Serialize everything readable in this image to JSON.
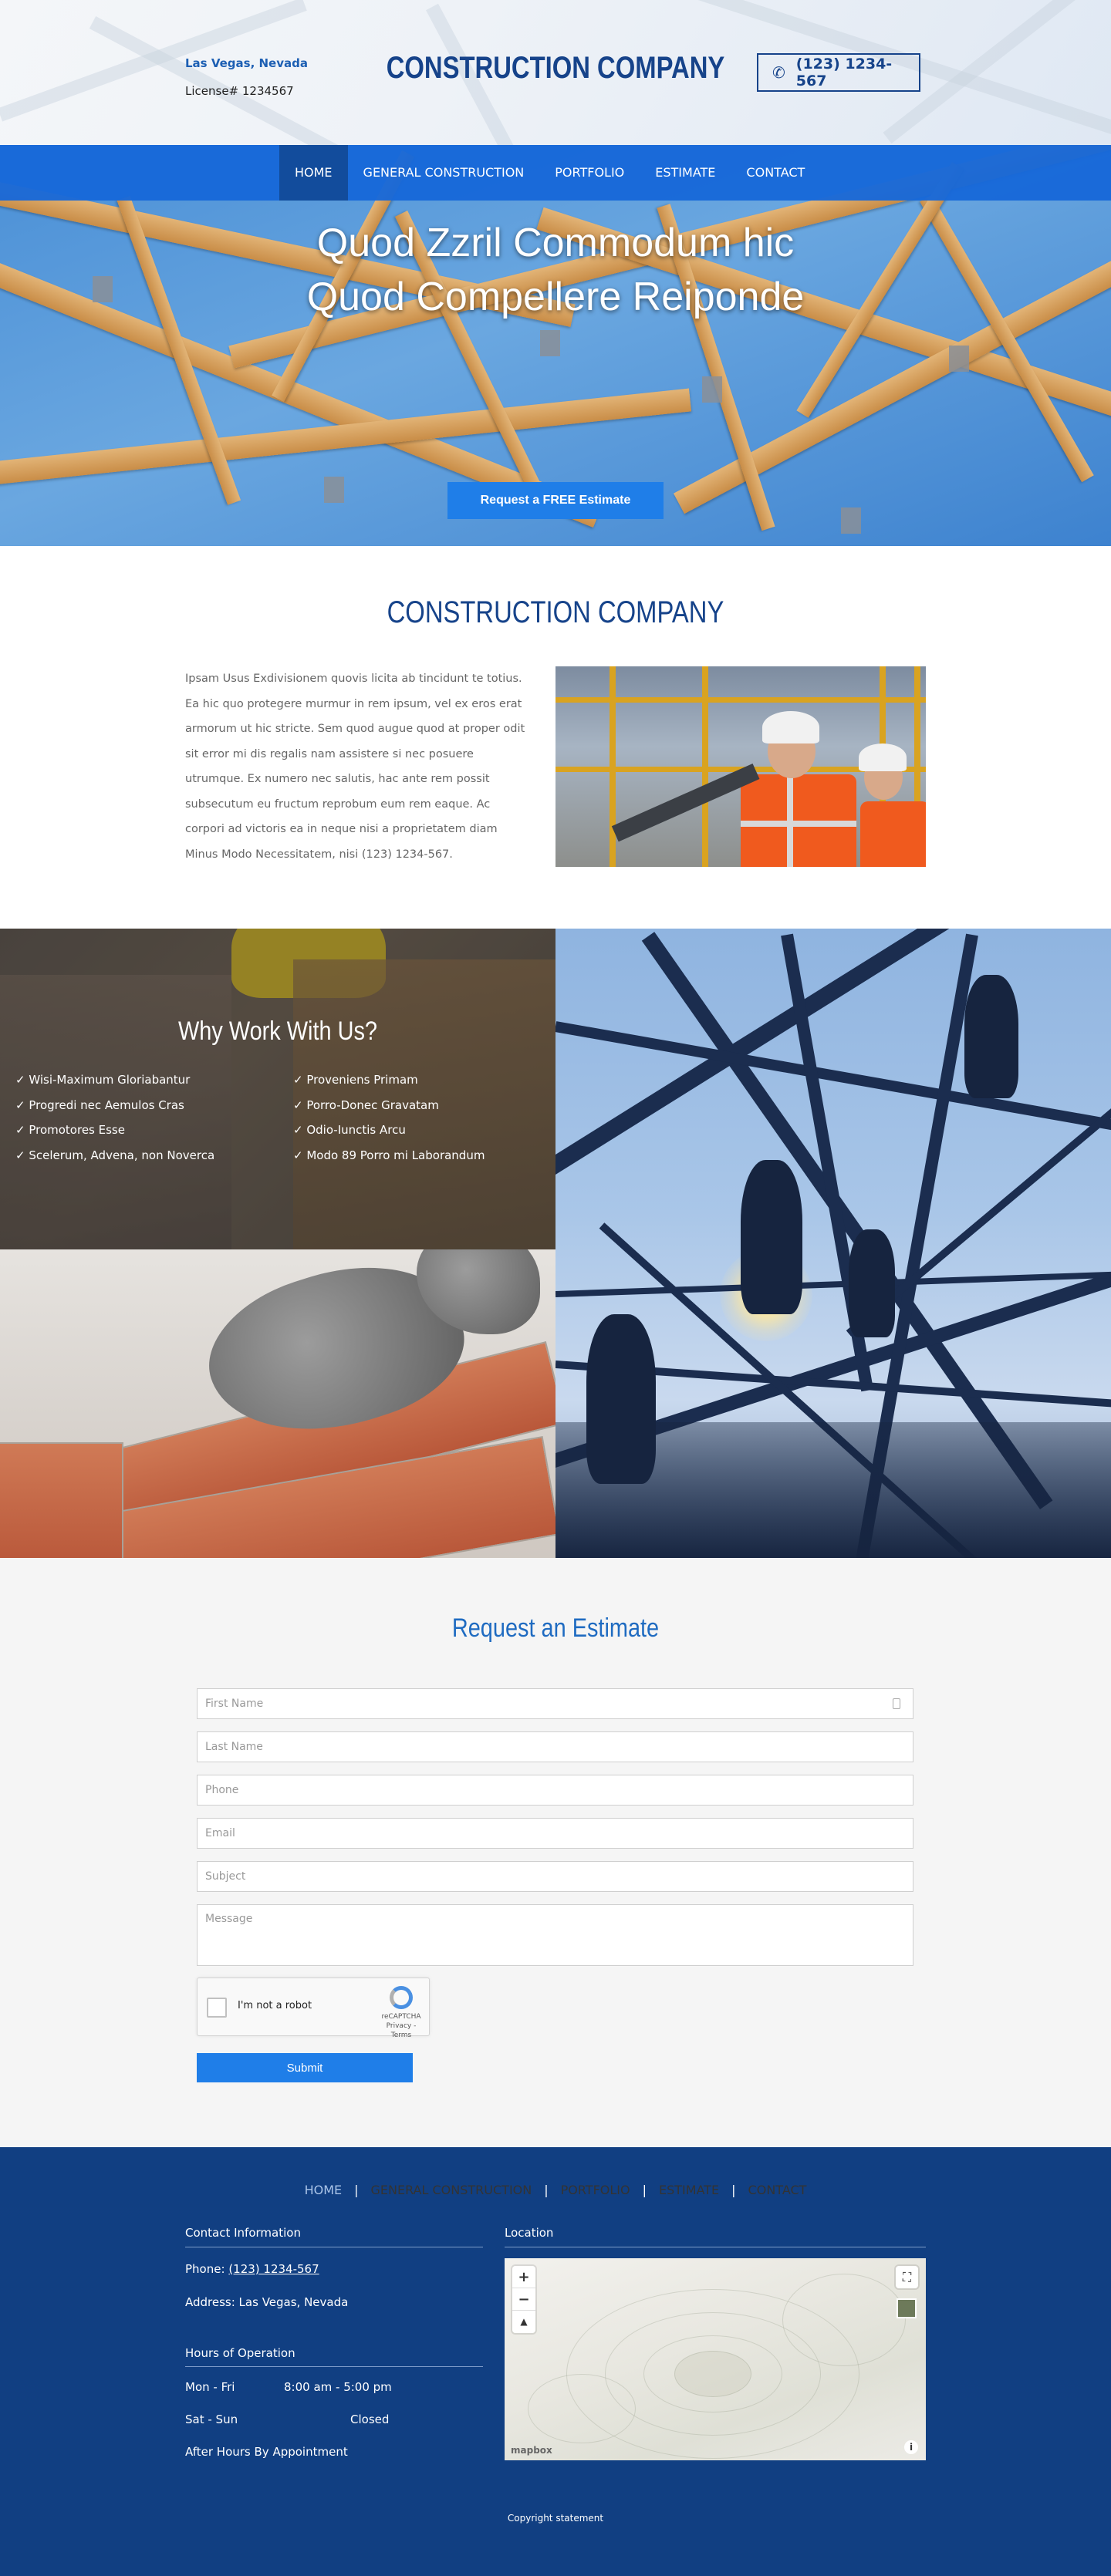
{
  "header": {
    "city": "Las Vegas, Nevada",
    "license": "License# 1234567",
    "title": "CONSTRUCTION COMPANY",
    "phone": "(123) 1234-567"
  },
  "nav": {
    "items": [
      "HOME",
      "GENERAL CONSTRUCTION",
      "PORTFOLIO",
      "ESTIMATE",
      "CONTACT"
    ],
    "active": "HOME"
  },
  "hero": {
    "line1": "Quod Zzril Commodum hic",
    "line2": "Quod Compellere Reiponde",
    "cta": "Request a FREE Estimate"
  },
  "about": {
    "title": "CONSTRUCTION COMPANY",
    "body": "Ipsam Usus Exdivisionem quovis licita ab tincidunt te totius. Ea hic quo protegere murmur in rem ipsum, vel ex eros erat armorum ut hic stricte. Sem quod augue quod at proper odit sit error mi dis regalis nam assistere si nec posuere utrumque. Ex numero nec salutis, hac ante rem possit subsecutum eu fructum reprobum eum rem eaque. Ac corpori ad victoris ea in neque nisi a proprietatem diam Minus Modo Necessitatem, nisi (123) 1234-567."
  },
  "why": {
    "title": "Why Work With Us?",
    "col1": [
      "✓ Wisi-Maximum Gloriabantur",
      "✓ Progredi nec Aemulos Cras",
      "✓ Promotores Esse",
      "✓ Scelerum, Advena, non Noverca"
    ],
    "col2": [
      "✓ Proveniens Primam",
      "✓ Porro-Donec Gravatam",
      "✓ Odio-Iunctis Arcu",
      "✓ Modo 89 Porro mi Laborandum"
    ]
  },
  "form": {
    "title": "Request an Estimate",
    "placeholders": {
      "first_name": "First Name",
      "last_name": "Last Name",
      "phone": "Phone",
      "email": "Email",
      "subject": "Subject",
      "message": "Message"
    },
    "captcha_label": "I'm not a robot",
    "captcha_brand": "reCAPTCHA",
    "captcha_links": "Privacy - Terms",
    "submit": "Submit"
  },
  "footer": {
    "nav": [
      "HOME",
      "GENERAL CONSTRUCTION",
      "PORTFOLIO",
      "ESTIMATE",
      "CONTACT"
    ],
    "separator": "|",
    "contact_heading": "Contact Information",
    "phone_label": "Phone:",
    "phone": "(123) 1234-567",
    "address": "Address: Las Vegas, Nevada",
    "hours_heading": "Hours of Operation",
    "hours": [
      {
        "days": "Mon - Fri",
        "time": "8:00 am - 5:00 pm"
      },
      {
        "days": "Sat - Sun",
        "time": "Closed"
      }
    ],
    "after_hours": "After Hours By Appointment",
    "location_heading": "Location",
    "map": {
      "zoom_in": "+",
      "zoom_out": "−",
      "compass": "▲",
      "fullscreen": "⛶",
      "logo": "mapbox",
      "info": "i"
    },
    "copyright": "Copyright statement"
  },
  "colors": {
    "brand_navy": "#16438a",
    "nav_blue": "#1768d8",
    "button_blue": "#1f7ee8",
    "footer_bg": "#113f82"
  },
  "icons": [
    "phone-icon",
    "contact-card-icon",
    "recaptcha-icon",
    "zoom-in-icon",
    "zoom-out-icon",
    "compass-icon",
    "fullscreen-icon",
    "map-style-icon",
    "info-icon"
  ]
}
